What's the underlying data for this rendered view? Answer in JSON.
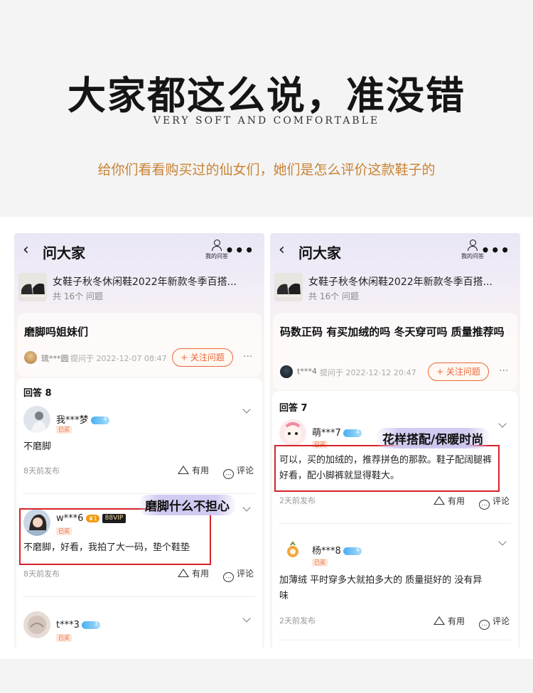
{
  "header": {
    "title": "大家都这么说，准没错",
    "subtitle": "VERY SOFT AND COMFORTABLE",
    "lead": "给你们看看购买过的仙女们，她们是怎么评价这款鞋子的"
  },
  "phone_left": {
    "nav_title": "问大家",
    "my_questions": "我的问答",
    "product_title": "女鞋子秋冬休闲鞋2022年新款冬季百搭...",
    "product_count": "共 16个 问题",
    "question": "磨脚吗姐妹们",
    "asker": "琉***圆",
    "asked_at": "提问于 2022-12-07 08:47",
    "follow": "+ 关注问题",
    "answer_count": "回答 8",
    "answers": [
      {
        "user": "我***梦",
        "level": "4",
        "bought": "已买",
        "text": "不磨脚",
        "ago": "8天前发布",
        "useful": "有用",
        "comment": "评论"
      },
      {
        "user": "w***6",
        "crown": "1",
        "vip": "88VIP",
        "bought": "已买",
        "text": "不磨脚，好看，我拍了大一码，垫个鞋垫",
        "ago": "8天前发布",
        "useful": "有用",
        "comment": "评论"
      },
      {
        "user": "t***3",
        "level": "3",
        "bought": "已买"
      }
    ],
    "callout": "磨脚什么不担心"
  },
  "phone_right": {
    "nav_title": "问大家",
    "my_questions": "我的问答",
    "product_title": "女鞋子秋冬休闲鞋2022年新款冬季百搭...",
    "product_count": "共 16个 问题",
    "question": "码数正码 有买加绒的吗 冬天穿可吗 质量推荐吗",
    "asker": "t***4",
    "asked_at": "提问于 2022-12-12 20:47",
    "follow": "+ 关注问题",
    "answer_count": "回答 7",
    "answers": [
      {
        "user": "萌***7",
        "level": "4",
        "bought": "已买",
        "text": "可以，买的加绒的，推荐拼色的那款。鞋子配阔腿裤好看，配小脚裤就显得鞋大。",
        "ago": "2天前发布",
        "useful": "有用",
        "comment": "评论"
      },
      {
        "user": "杨***8",
        "level": "4",
        "bought": "已买",
        "text": "加薄绒 平时穿多大就拍多大的 质量挺好的 没有异味",
        "ago": "2天前发布",
        "useful": "有用",
        "comment": "评论"
      }
    ],
    "callout": "花样搭配/保暖时尚"
  }
}
